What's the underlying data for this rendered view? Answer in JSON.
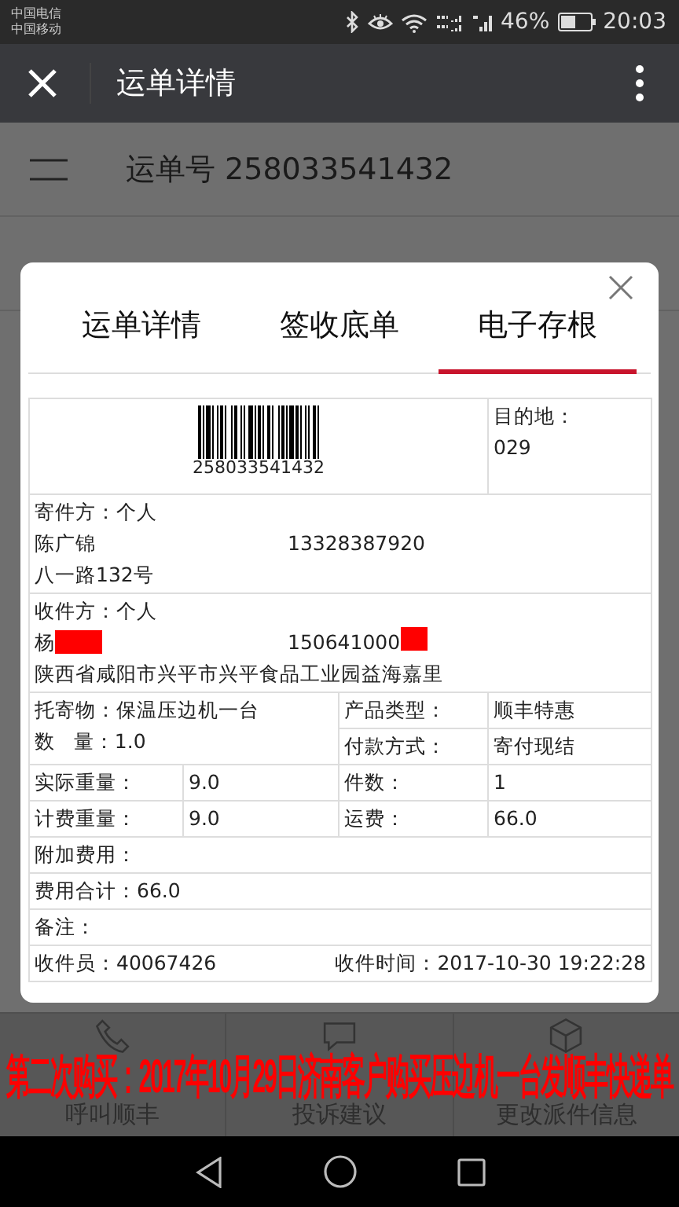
{
  "status_bar": {
    "carriers": [
      "中国电信",
      "中国移动"
    ],
    "battery": "46%",
    "time": "20:03"
  },
  "app_bar": {
    "title": "运单详情"
  },
  "waybill_header": {
    "label": "运单号 258033541432"
  },
  "modal": {
    "tabs": [
      {
        "label": "运单详情",
        "selected": false
      },
      {
        "label": "签收底单",
        "selected": false
      },
      {
        "label": "电子存根",
        "selected": true
      }
    ],
    "barcode_number": "258033541432",
    "destination": {
      "label": "目的地：",
      "value": "029"
    },
    "sender": {
      "label": "寄件方：个人",
      "name": "陈广锦",
      "name_redacted": false,
      "phone": "13328387920",
      "phone_redacted": false,
      "address": "八一路132号"
    },
    "receiver": {
      "label": "收件方：个人",
      "name": "杨",
      "name_redacted": true,
      "phone": "150641000",
      "phone_redacted": true,
      "address": "陕西省咸阳市兴平市兴平食品工业园益海嘉里"
    },
    "goods": {
      "item": "托寄物：保温压边机一台",
      "quantity_label": "数   量：",
      "quantity": "1.0"
    },
    "product_type": {
      "label": "产品类型：",
      "value": "顺丰特惠"
    },
    "payment": {
      "label": "付款方式：",
      "value": "寄付现结"
    },
    "actual_weight": {
      "label": "实际重量：",
      "value": "9.0"
    },
    "pieces": {
      "label": "件数：",
      "value": "1"
    },
    "charged_weight": {
      "label": "计费重量：",
      "value": "9.0"
    },
    "freight": {
      "label": "运费：",
      "value": "66.0"
    },
    "extra_fee": "附加费用：",
    "total": "费用合计：66.0",
    "remark": "备注：",
    "courier": "收件员：40067426",
    "pickup_time": "收件时间：2017-10-30 19:22:28"
  },
  "bottom_actions": [
    {
      "label": "呼叫顺丰",
      "kind": "phone"
    },
    {
      "label": "投诉建议",
      "kind": "chat"
    },
    {
      "label": "更改派件信息",
      "kind": "box"
    }
  ],
  "annotation": "第二次购买：2017年10月29日济南客户购买压边机一台发顺丰快递单"
}
